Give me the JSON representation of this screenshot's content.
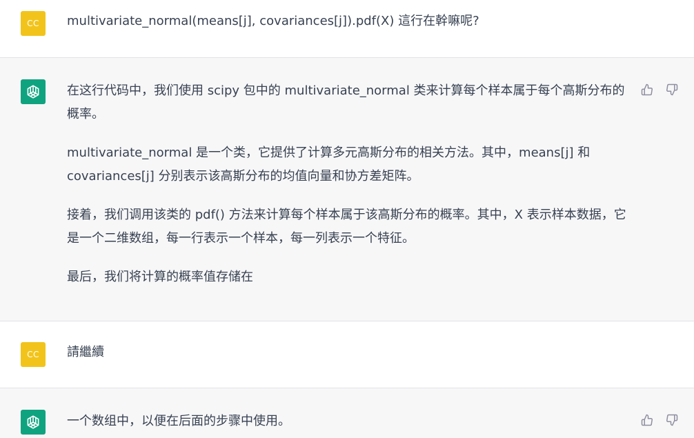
{
  "conversation": {
    "messages": [
      {
        "role": "user",
        "avatar_text": "CC",
        "paragraphs": [
          "multivariate_normal(means[j], covariances[j]).pdf(X) 這行在幹嘛呢?"
        ]
      },
      {
        "role": "assistant",
        "paragraphs": [
          "在这行代码中，我们使用 scipy 包中的 multivariate_normal 类来计算每个样本属于每个高斯分布的概率。",
          "multivariate_normal 是一个类，它提供了计算多元高斯分布的相关方法。其中，means[j] 和 covariances[j] 分别表示该高斯分布的均值向量和协方差矩阵。",
          "接着，我们调用该类的 pdf() 方法来计算每个样本属于该高斯分布的概率。其中，X 表示样本数据，它是一个二维数组，每一行表示一个样本，每一列表示一个特征。",
          "最后，我们将计算的概率值存储在"
        ]
      },
      {
        "role": "user",
        "avatar_text": "CC",
        "paragraphs": [
          "請繼續"
        ]
      },
      {
        "role": "assistant",
        "paragraphs": [
          "一个数组中，以便在后面的步骤中使用。"
        ]
      }
    ]
  },
  "icons": {
    "assistant_avatar": "openai-logo-icon",
    "thumbs_up": "thumbs-up-icon",
    "thumbs_down": "thumbs-down-icon"
  },
  "colors": {
    "user_avatar_bg": "#f2c41b",
    "assistant_avatar_bg": "#10a37f",
    "assistant_block_bg": "#f7f7f8",
    "text": "#374151"
  }
}
